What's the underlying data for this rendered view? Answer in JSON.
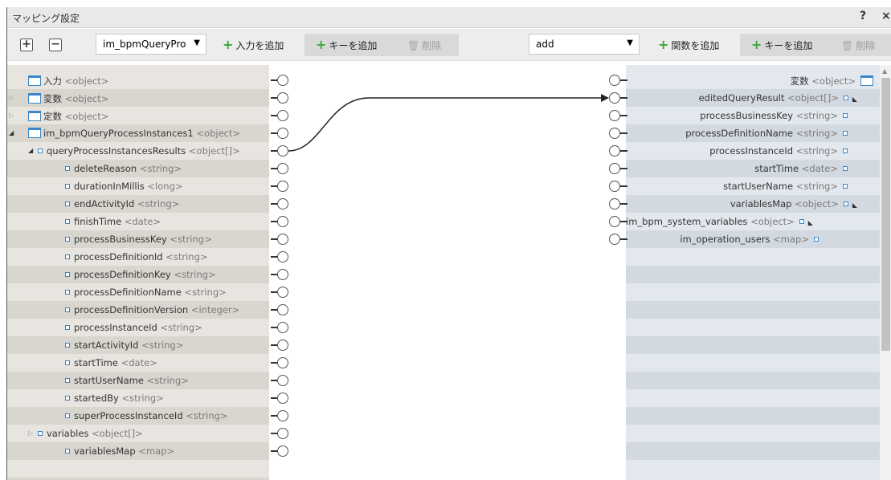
{
  "window": {
    "title": "マッピング設定",
    "help": "?",
    "close": "×"
  },
  "toolbar": {
    "expand_label": "+",
    "collapse_label": "−",
    "source_select": "im_bpmQueryPro",
    "add_input": "入力を追加",
    "add_key_left": "キーを追加",
    "delete_left": "削除",
    "function_select": "add",
    "add_function": "関数を追加",
    "add_key_right": "キーを追加",
    "delete_right": "削除"
  },
  "left_tree": [
    {
      "name": "入力",
      "type": "<object>",
      "level": 0,
      "icon": "object",
      "expander": "none"
    },
    {
      "name": "変数",
      "type": "<object>",
      "level": 0,
      "icon": "object",
      "expander": "closed"
    },
    {
      "name": "定数",
      "type": "<object>",
      "level": 0,
      "icon": "object",
      "expander": "closed"
    },
    {
      "name": "im_bpmQueryProcessInstances1",
      "type": "<object>",
      "level": 0,
      "icon": "object",
      "expander": "open"
    },
    {
      "name": "queryProcessInstancesResults",
      "type": "<object[]>",
      "level": 1,
      "icon": "small",
      "expander": "open"
    },
    {
      "name": "deleteReason",
      "type": "<string>",
      "level": 2,
      "icon": "small",
      "expander": "none"
    },
    {
      "name": "durationInMillis",
      "type": "<long>",
      "level": 2,
      "icon": "small",
      "expander": "none"
    },
    {
      "name": "endActivityId",
      "type": "<string>",
      "level": 2,
      "icon": "small",
      "expander": "none"
    },
    {
      "name": "finishTime",
      "type": "<date>",
      "level": 2,
      "icon": "small",
      "expander": "none"
    },
    {
      "name": "processBusinessKey",
      "type": "<string>",
      "level": 2,
      "icon": "small",
      "expander": "none"
    },
    {
      "name": "processDefinitionId",
      "type": "<string>",
      "level": 2,
      "icon": "small",
      "expander": "none"
    },
    {
      "name": "processDefinitionKey",
      "type": "<string>",
      "level": 2,
      "icon": "small",
      "expander": "none"
    },
    {
      "name": "processDefinitionName",
      "type": "<string>",
      "level": 2,
      "icon": "small",
      "expander": "none"
    },
    {
      "name": "processDefinitionVersion",
      "type": "<integer>",
      "level": 2,
      "icon": "small",
      "expander": "none"
    },
    {
      "name": "processInstanceId",
      "type": "<string>",
      "level": 2,
      "icon": "small",
      "expander": "none"
    },
    {
      "name": "startActivityId",
      "type": "<string>",
      "level": 2,
      "icon": "small",
      "expander": "none"
    },
    {
      "name": "startTime",
      "type": "<date>",
      "level": 2,
      "icon": "small",
      "expander": "none"
    },
    {
      "name": "startUserName",
      "type": "<string>",
      "level": 2,
      "icon": "small",
      "expander": "none"
    },
    {
      "name": "startedBy",
      "type": "<string>",
      "level": 2,
      "icon": "small",
      "expander": "none"
    },
    {
      "name": "superProcessInstanceId",
      "type": "<string>",
      "level": 2,
      "icon": "small",
      "expander": "none"
    },
    {
      "name": "variables",
      "type": "<object[]>",
      "level": 1,
      "icon": "small",
      "expander": "closed"
    },
    {
      "name": "variablesMap",
      "type": "<map>",
      "level": 2,
      "icon": "small",
      "expander": "none"
    }
  ],
  "right_tree": [
    {
      "name": "変数",
      "type": "<object>",
      "icon": "object",
      "more": false
    },
    {
      "name": "editedQueryResult",
      "type": "<object[]>",
      "icon": "small",
      "more": true
    },
    {
      "name": "processBusinessKey",
      "type": "<string>",
      "icon": "small",
      "more": false
    },
    {
      "name": "processDefinitionName",
      "type": "<string>",
      "icon": "small",
      "more": false
    },
    {
      "name": "processInstanceId",
      "type": "<string>",
      "icon": "small",
      "more": false
    },
    {
      "name": "startTime",
      "type": "<date>",
      "icon": "small",
      "more": false
    },
    {
      "name": "startUserName",
      "type": "<string>",
      "icon": "small",
      "more": false
    },
    {
      "name": "variablesMap",
      "type": "<object>",
      "icon": "small",
      "more": true
    },
    {
      "name": "im_bpm_system_variables",
      "type": "<object>",
      "icon": "small",
      "more": true
    },
    {
      "name": "im_operation_users",
      "type": "<map>",
      "icon": "small",
      "more": false
    }
  ],
  "connections": [
    {
      "from_left_row": 4,
      "to_right_row": 1
    }
  ],
  "colors": {
    "accent": "#3b86c6",
    "add_green": "#3aa83a"
  }
}
